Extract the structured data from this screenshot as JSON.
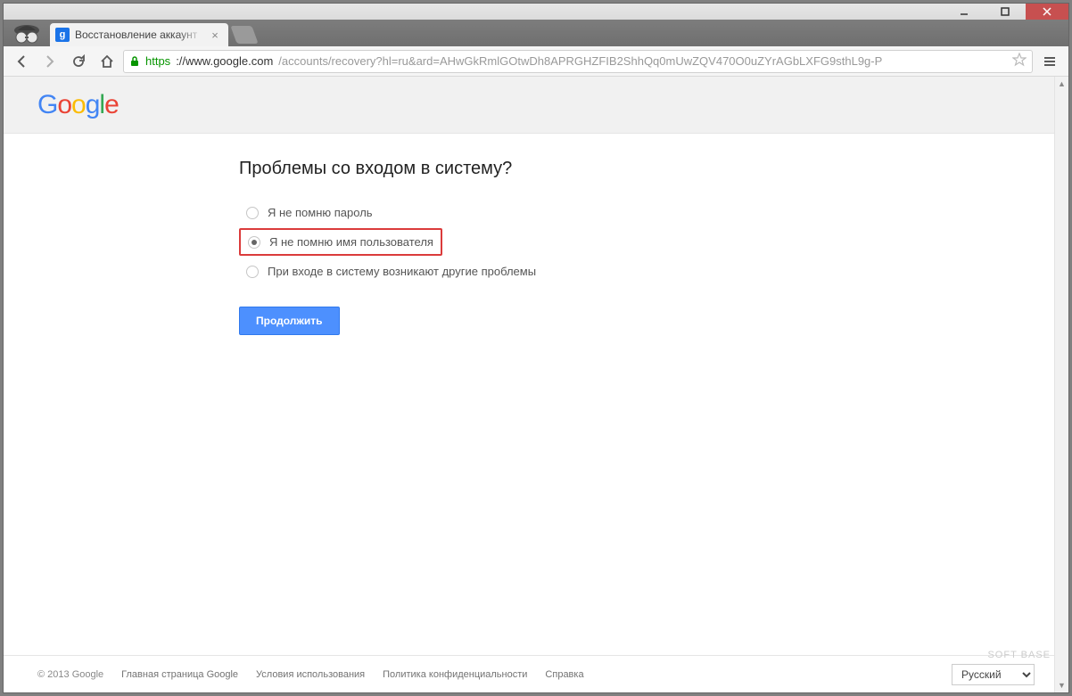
{
  "browser": {
    "tab_title": "Восстановление аккаунт",
    "url_scheme": "https",
    "url_host": "://www.google.com",
    "url_path": "/accounts/recovery?hl=ru&ard=AHwGkRmlGOtwDh8APRGHZFIB2ShhQq0mUwZQV470O0uZYrAGbLXFG9sthL9g-P"
  },
  "page": {
    "logo_letters": [
      "G",
      "o",
      "o",
      "g",
      "l",
      "e"
    ],
    "heading": "Проблемы со входом в систему?",
    "options": {
      "forgot_password": "Я не помню пароль",
      "forgot_username": "Я не помню имя пользователя",
      "other_problems": "При входе в систему возникают другие проблемы"
    },
    "continue_label": "Продолжить"
  },
  "footer": {
    "copyright": "© 2013 Google",
    "links": {
      "home": "Главная страница Google",
      "terms": "Условия использования",
      "privacy": "Политика конфиденциальности",
      "help": "Справка"
    },
    "language_selected": "Русский"
  },
  "watermark": "SOFT BASE"
}
